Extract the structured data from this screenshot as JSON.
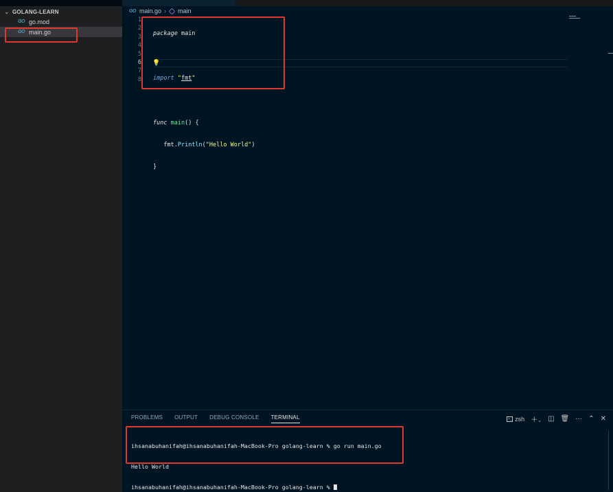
{
  "sidebar": {
    "section_title": "GOLANG-LEARN",
    "files": [
      {
        "icon": "GO",
        "name": "go.mod"
      },
      {
        "icon": "GO",
        "name": "main.go"
      }
    ]
  },
  "editor": {
    "breadcrumb": {
      "file_icon": "GO",
      "file": "main.go",
      "symbol": "main"
    },
    "line_numbers": [
      "1",
      "2",
      "3",
      "4",
      "5",
      "6",
      "7",
      "8"
    ],
    "active_line": "6",
    "code": {
      "line1_kw": "package",
      "line1_name": "main",
      "line3_kw": "import",
      "line3_str": "\"fmt\"",
      "line3_q1": "\"",
      "line3_pkg": "fmt",
      "line3_q2": "\"",
      "line5_kw": "func",
      "line5_fn": "main",
      "line5_rest": "() {",
      "line6_pkg": "fmt",
      "line6_dot": ".",
      "line6_method": "Println",
      "line6_open": "(",
      "line6_str": "\"Hello World\"",
      "line6_close": ")",
      "line7": "}"
    }
  },
  "panel": {
    "tabs": [
      "PROBLEMS",
      "OUTPUT",
      "DEBUG CONSOLE",
      "TERMINAL"
    ],
    "active_tab": "TERMINAL",
    "shell_name": "zsh",
    "terminal_lines": [
      "ihsanabuhanifah@ihsanabuhanifah-MacBook-Pro golang-learn % go run main.go",
      "Hello World",
      "ihsanabuhanifah@ihsanabuhanifah-MacBook-Pro golang-learn % "
    ]
  },
  "colors": {
    "annotation": "#e03a2f",
    "editor_bg": "#001524",
    "sidebar_bg": "#1e1f20",
    "go_icon": "#519aba"
  }
}
